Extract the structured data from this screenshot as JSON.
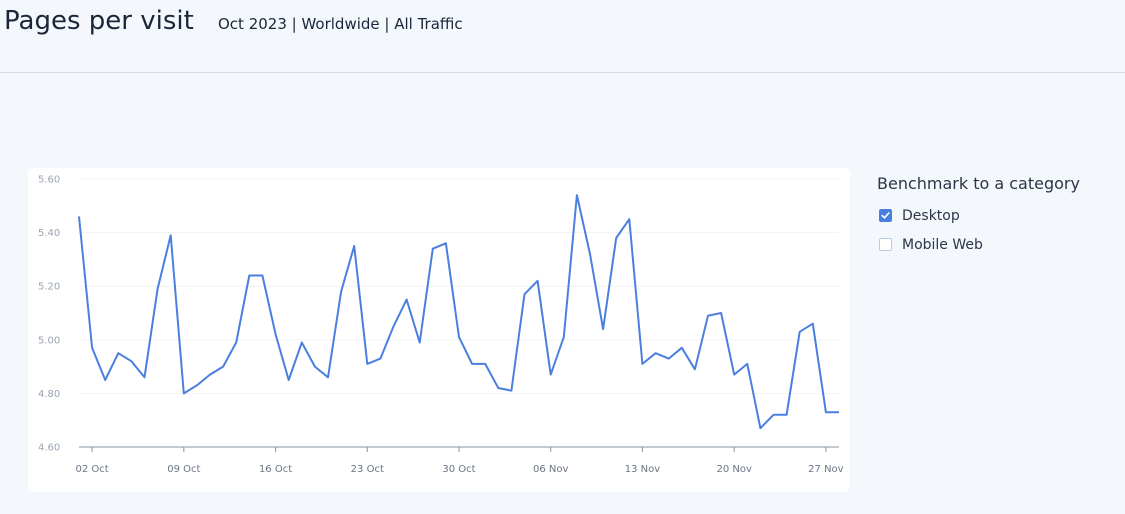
{
  "header": {
    "title": "Pages per visit",
    "subtitle": "Oct 2023 | Worldwide | All Traffic"
  },
  "legend": {
    "title": "Benchmark to a category",
    "items": [
      {
        "label": "Desktop",
        "checked": true
      },
      {
        "label": "Mobile Web",
        "checked": false
      }
    ]
  },
  "colors": {
    "line": "#4a7fe0",
    "checkbox_checked": "#4a7fe0"
  },
  "chart_data": {
    "type": "line",
    "title": "",
    "xlabel": "",
    "ylabel": "",
    "ylim": [
      4.6,
      5.6
    ],
    "y_ticks": [
      "5.60",
      "5.40",
      "5.20",
      "5.00",
      "4.80",
      "4.60"
    ],
    "y_tick_values": [
      5.6,
      5.4,
      5.2,
      5.0,
      4.8,
      4.6
    ],
    "x_ticks": [
      {
        "label": "02 Oct",
        "date": "2023-10-02"
      },
      {
        "label": "09 Oct",
        "date": "2023-10-09"
      },
      {
        "label": "16 Oct",
        "date": "2023-10-16"
      },
      {
        "label": "23 Oct",
        "date": "2023-10-23"
      },
      {
        "label": "30 Oct",
        "date": "2023-10-30"
      },
      {
        "label": "06 Nov",
        "date": "2023-11-06"
      },
      {
        "label": "13 Nov",
        "date": "2023-11-13"
      },
      {
        "label": "20 Nov",
        "date": "2023-11-20"
      },
      {
        "label": "27 Nov",
        "date": "2023-11-27"
      }
    ],
    "grid": true,
    "series": [
      {
        "color": "#4a7fe0",
        "x": [
          "2023-10-01",
          "2023-10-02",
          "2023-10-03",
          "2023-10-04",
          "2023-10-05",
          "2023-10-06",
          "2023-10-07",
          "2023-10-08",
          "2023-10-09",
          "2023-10-10",
          "2023-10-11",
          "2023-10-12",
          "2023-10-13",
          "2023-10-14",
          "2023-10-15",
          "2023-10-16",
          "2023-10-17",
          "2023-10-18",
          "2023-10-19",
          "2023-10-20",
          "2023-10-21",
          "2023-10-22",
          "2023-10-23",
          "2023-10-24",
          "2023-10-25",
          "2023-10-26",
          "2023-10-27",
          "2023-10-28",
          "2023-10-29",
          "2023-10-30",
          "2023-10-31",
          "2023-11-01",
          "2023-11-02",
          "2023-11-03",
          "2023-11-04",
          "2023-11-05",
          "2023-11-06",
          "2023-11-07",
          "2023-11-08",
          "2023-11-09",
          "2023-11-10",
          "2023-11-11",
          "2023-11-12",
          "2023-11-13",
          "2023-11-14",
          "2023-11-15",
          "2023-11-16",
          "2023-11-17",
          "2023-11-18",
          "2023-11-19",
          "2023-11-20",
          "2023-11-21",
          "2023-11-22",
          "2023-11-23",
          "2023-11-24",
          "2023-11-25",
          "2023-11-26",
          "2023-11-27",
          "2023-11-28"
        ],
        "values": [
          5.46,
          4.97,
          4.85,
          4.95,
          4.92,
          4.86,
          5.19,
          5.39,
          4.8,
          4.83,
          4.87,
          4.9,
          4.99,
          5.24,
          5.24,
          5.02,
          4.85,
          4.99,
          4.9,
          4.86,
          5.18,
          5.35,
          4.91,
          4.93,
          5.05,
          5.15,
          4.99,
          5.34,
          5.36,
          5.01,
          4.91,
          4.91,
          4.82,
          4.81,
          5.17,
          5.22,
          4.87,
          5.01,
          5.54,
          5.32,
          5.04,
          5.38,
          5.45,
          4.91,
          4.95,
          4.93,
          4.97,
          4.89,
          5.09,
          5.1,
          4.87,
          4.91,
          4.67,
          4.72,
          4.72,
          5.03,
          5.06,
          4.73,
          4.73
        ]
      }
    ]
  }
}
